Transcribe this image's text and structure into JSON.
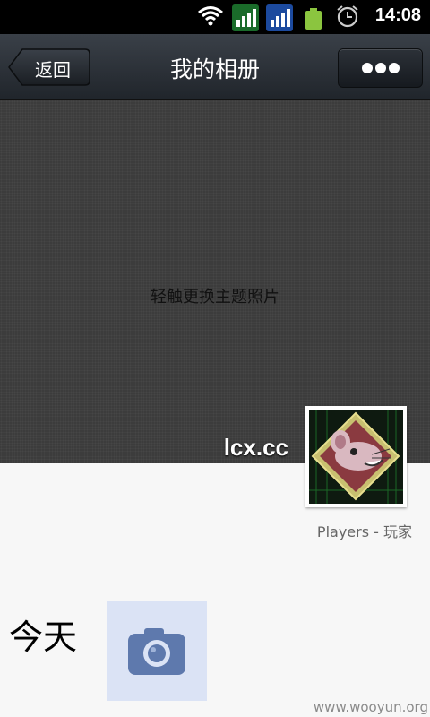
{
  "status_bar": {
    "time": "14:08",
    "icons": [
      "wifi-icon",
      "signal-icon",
      "signal-icon",
      "battery-icon",
      "alarm-icon"
    ],
    "colors": {
      "sig1": "#1a6b2a",
      "sig2": "#1c4a9e",
      "battery": "#8bc53f"
    }
  },
  "titlebar": {
    "back_label": "返回",
    "title": "我的相册",
    "more_icon": "more-dots-icon"
  },
  "cover": {
    "hint": "轻触更换主题照片",
    "username": "lcx.cc"
  },
  "avatar": {
    "caption": "Players - 玩家"
  },
  "timeline": {
    "day_label": "今天",
    "camera_icon": "camera-icon",
    "tile_color": "#dbe3f5"
  },
  "watermark": "www.wooyun.org"
}
